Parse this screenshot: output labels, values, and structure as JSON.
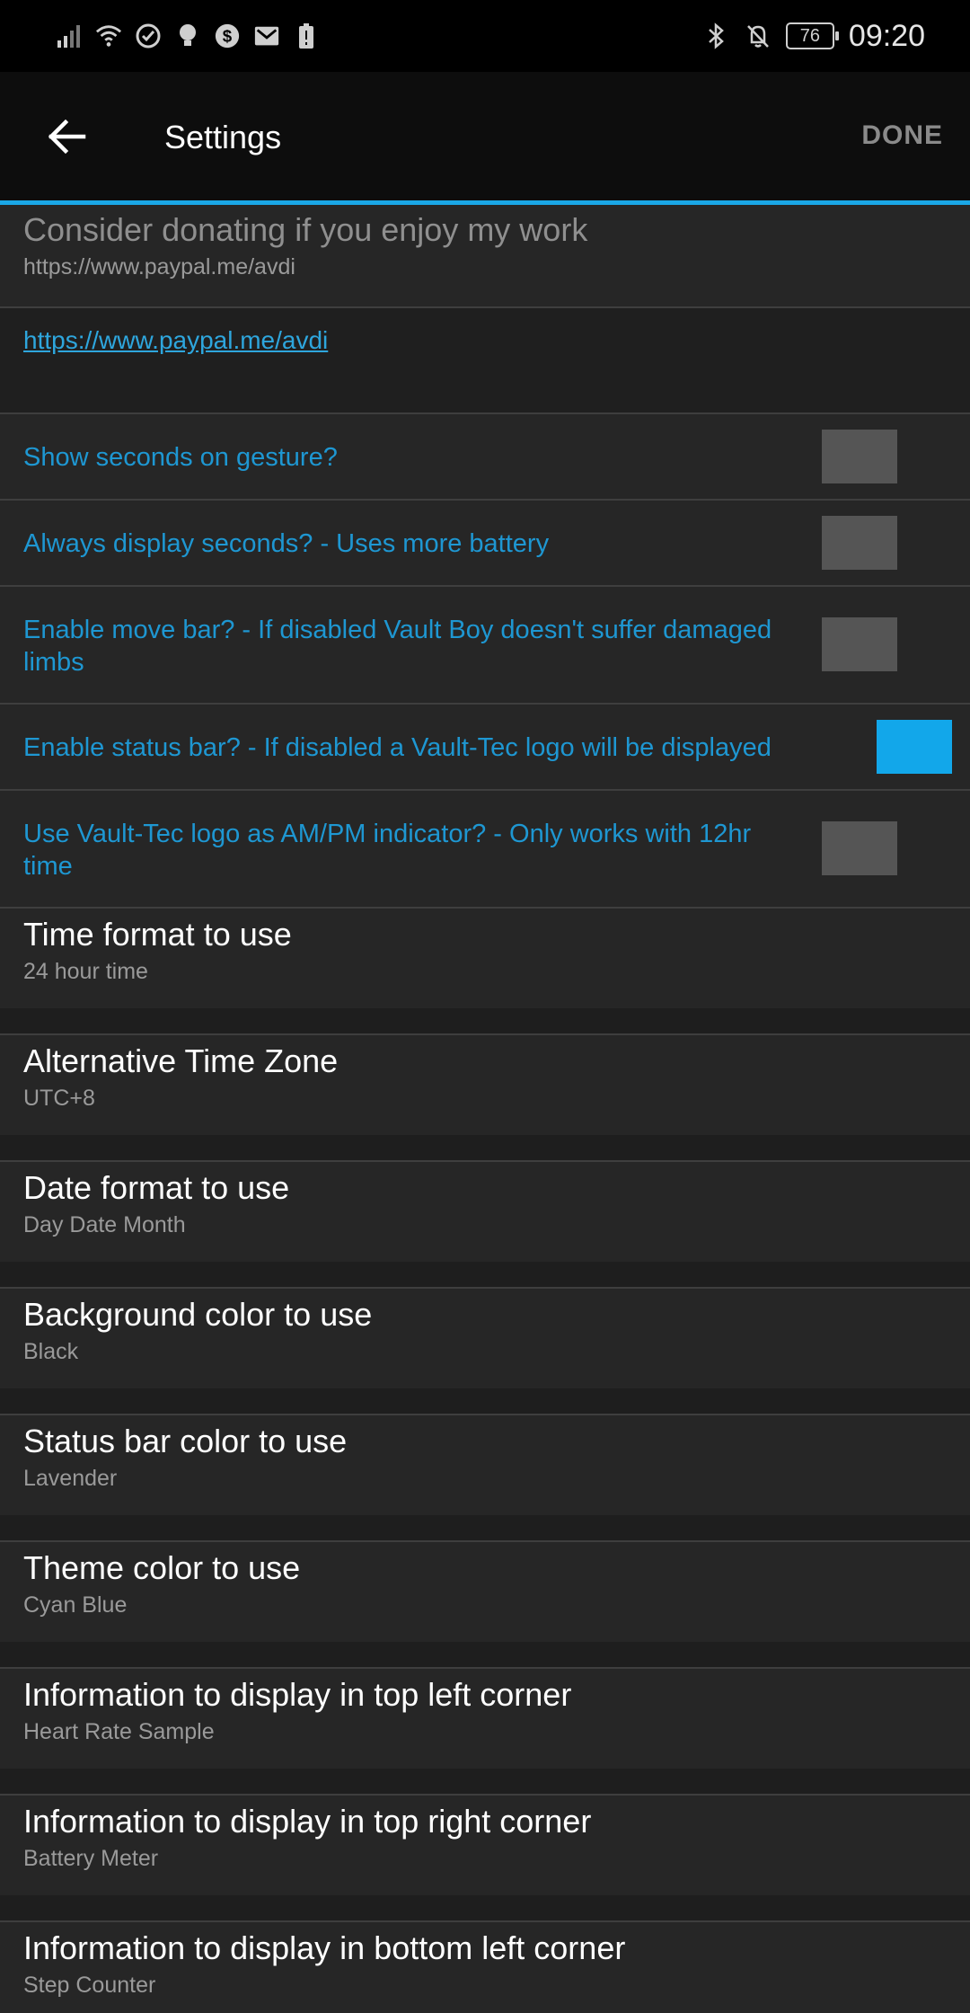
{
  "status_bar": {
    "time": "09:20",
    "battery": "76",
    "icons": [
      "signal-icon",
      "wifi-icon",
      "check-circle-icon",
      "lightbulb-icon",
      "dollar-icon",
      "mail-icon",
      "battery-alert-icon",
      "bluetooth-icon",
      "bell-off-icon"
    ]
  },
  "toolbar": {
    "title": "Settings",
    "done_label": "DONE",
    "back_icon": "arrow-left-icon"
  },
  "accent_color": "#1aa7e6",
  "donate": {
    "title": "Consider donating if you enjoy my work",
    "subtitle": "https://www.paypal.me/avdi",
    "link": "https://www.paypal.me/avdi"
  },
  "checkboxes": [
    {
      "label": "Show seconds on gesture?",
      "checked": false
    },
    {
      "label": "Always display seconds? - Uses more battery",
      "checked": false
    },
    {
      "label": "Enable move bar? - If disabled Vault Boy doesn't suffer damaged limbs",
      "checked": false
    },
    {
      "label": "Enable status bar? - If disabled a Vault-Tec logo will be displayed",
      "checked": true
    },
    {
      "label": "Use Vault-Tec logo as AM/PM indicator? - Only works with 12hr time",
      "checked": false
    }
  ],
  "settings": [
    {
      "title": "Time format to use",
      "value": "24 hour time"
    },
    {
      "title": "Alternative Time Zone",
      "value": "UTC+8"
    },
    {
      "title": "Date format to use",
      "value": "Day Date Month"
    },
    {
      "title": "Background color to use",
      "value": "Black"
    },
    {
      "title": "Status bar color to use",
      "value": "Lavender"
    },
    {
      "title": "Theme color to use",
      "value": "Cyan Blue"
    },
    {
      "title": "Information to display in top left corner",
      "value": "Heart Rate Sample"
    },
    {
      "title": "Information to display in top right corner",
      "value": "Battery Meter"
    },
    {
      "title": "Information to display in bottom left corner",
      "value": "Step Counter"
    }
  ]
}
